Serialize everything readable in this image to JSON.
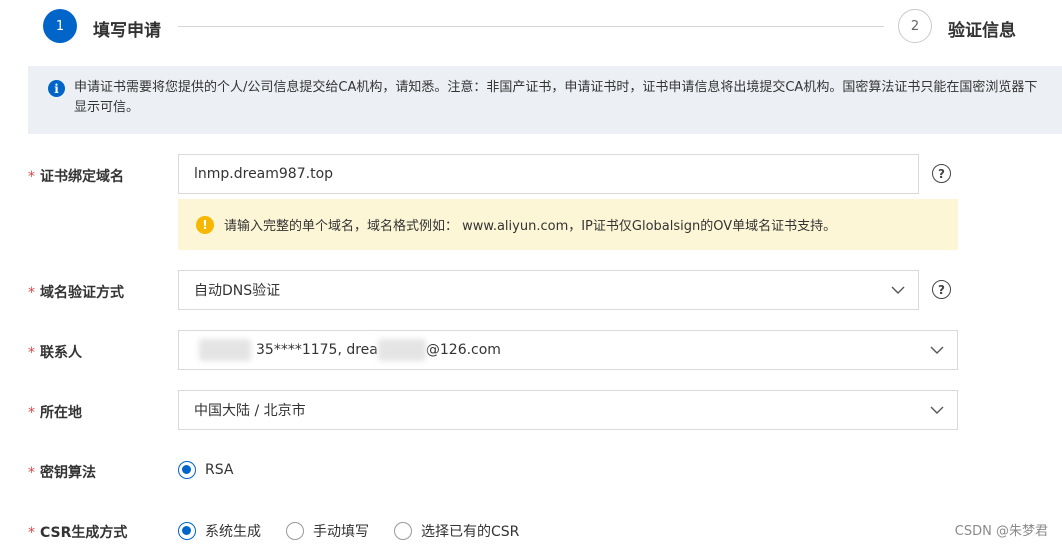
{
  "steps": [
    {
      "number": "1",
      "label": "填写申请",
      "active": true
    },
    {
      "number": "2",
      "label": "验证信息",
      "active": false
    }
  ],
  "notice": {
    "icon": "info-icon",
    "text": "申请证书需要将您提供的个人/公司信息提交给CA机构，请知悉。注意：非国产证书，申请证书时，证书申请信息将出境提交CA机构。国密算法证书只能在国密浏览器下显示可信。"
  },
  "form": {
    "domain": {
      "label": "证书绑定域名",
      "value": "lnmp.dream987.top",
      "warning": "请输入完整的单个域名，域名格式例如： www.aliyun.com，IP证书仅Globalsign的OV单域名证书支持。"
    },
    "verify_method": {
      "label": "域名验证方式",
      "value": "自动DNS验证"
    },
    "contact": {
      "label": "联系人",
      "value_part1": "35****1175, drea",
      "value_part2": "@126.com"
    },
    "location": {
      "label": "所在地",
      "value": "中国大陆 / 北京市"
    },
    "algorithm": {
      "label": "密钥算法",
      "options": [
        {
          "label": "RSA",
          "checked": true
        }
      ]
    },
    "csr": {
      "label": "CSR生成方式",
      "options": [
        {
          "label": "系统生成",
          "checked": true
        },
        {
          "label": "手动填写",
          "checked": false
        },
        {
          "label": "选择已有的CSR",
          "checked": false
        }
      ]
    }
  },
  "required_mark": "*",
  "help_icon_glyph": "?",
  "watermark": "CSDN @朱梦君",
  "colors": {
    "primary": "#0064c8",
    "required": "#e54545",
    "warning_bg": "#fdf6d6",
    "notice_bg": "#ecf0f5"
  }
}
